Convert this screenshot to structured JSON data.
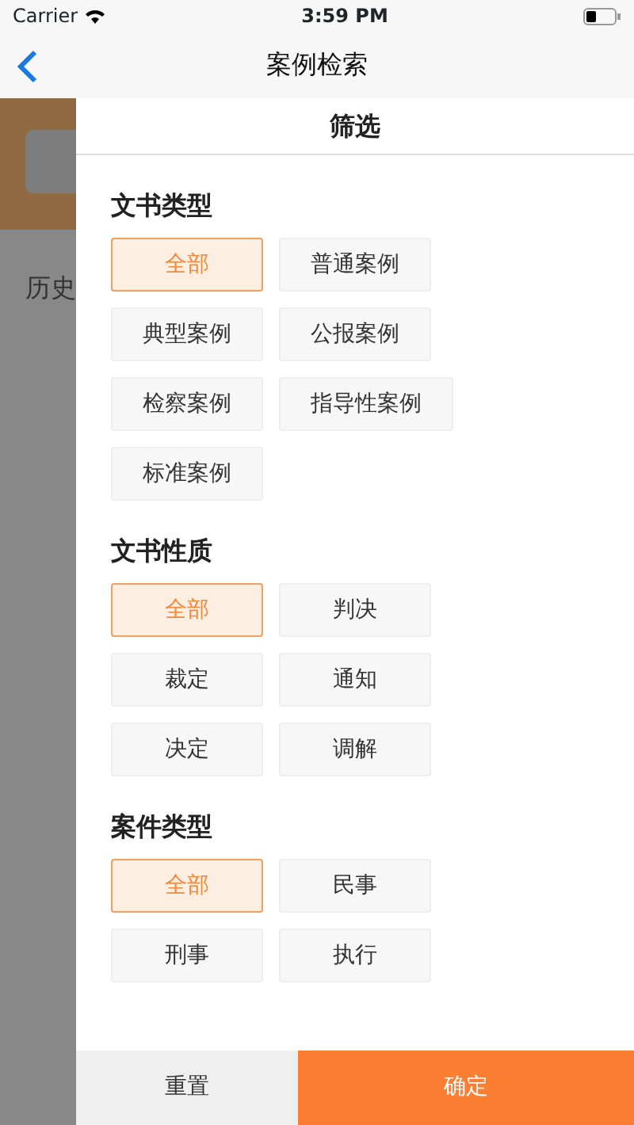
{
  "status_bar": {
    "carrier": "Carrier",
    "time": "3:59 PM"
  },
  "nav": {
    "title": "案例检索"
  },
  "background": {
    "history_label": "历史"
  },
  "drawer": {
    "title": "筛选",
    "sections": [
      {
        "title": "文书类型",
        "options": [
          {
            "label": "全部",
            "selected": true
          },
          {
            "label": "普通案例",
            "selected": false
          },
          {
            "label": "典型案例",
            "selected": false
          },
          {
            "label": "公报案例",
            "selected": false
          },
          {
            "label": "检察案例",
            "selected": false
          },
          {
            "label": "指导性案例",
            "selected": false
          },
          {
            "label": "标准案例",
            "selected": false
          }
        ]
      },
      {
        "title": "文书性质",
        "options": [
          {
            "label": "全部",
            "selected": true
          },
          {
            "label": "判决",
            "selected": false
          },
          {
            "label": "裁定",
            "selected": false
          },
          {
            "label": "通知",
            "selected": false
          },
          {
            "label": "决定",
            "selected": false
          },
          {
            "label": "调解",
            "selected": false
          }
        ]
      },
      {
        "title": "案件类型",
        "options": [
          {
            "label": "全部",
            "selected": true
          },
          {
            "label": "民事",
            "selected": false
          },
          {
            "label": "刑事",
            "selected": false
          },
          {
            "label": "执行",
            "selected": false
          }
        ]
      }
    ],
    "reset_label": "重置",
    "confirm_label": "确定"
  }
}
